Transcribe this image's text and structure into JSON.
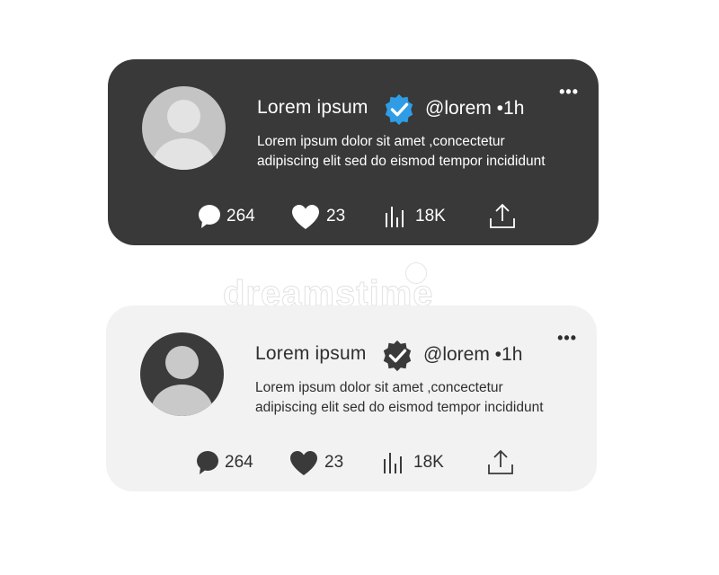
{
  "posts": [
    {
      "theme": "dark",
      "name": "Lorem ipsum",
      "handle": "@lorem",
      "time": "1h",
      "text_line1": "Lorem ipsum dolor sit amet ,concectetur",
      "text_line2": "adipiscing elit sed do eismod tempor incididunt",
      "comments": "264",
      "likes": "23",
      "views": "18K",
      "more_label": "•••",
      "badge_color": "#2f9ce6"
    },
    {
      "theme": "light",
      "name": "Lorem ipsum",
      "handle": "@lorem",
      "time": "1h",
      "text_line1": "Lorem ipsum dolor sit amet ,concectetur",
      "text_line2": "adipiscing elit sed do eismod tempor incididunt",
      "comments": "264",
      "likes": "23",
      "views": "18K",
      "more_label": "•••",
      "badge_color": "#3a3a3a"
    }
  ],
  "watermark": "dreamstime",
  "icons": [
    "comment-icon",
    "heart-icon",
    "views-icon",
    "share-icon",
    "verified-badge-icon",
    "more-icon"
  ]
}
